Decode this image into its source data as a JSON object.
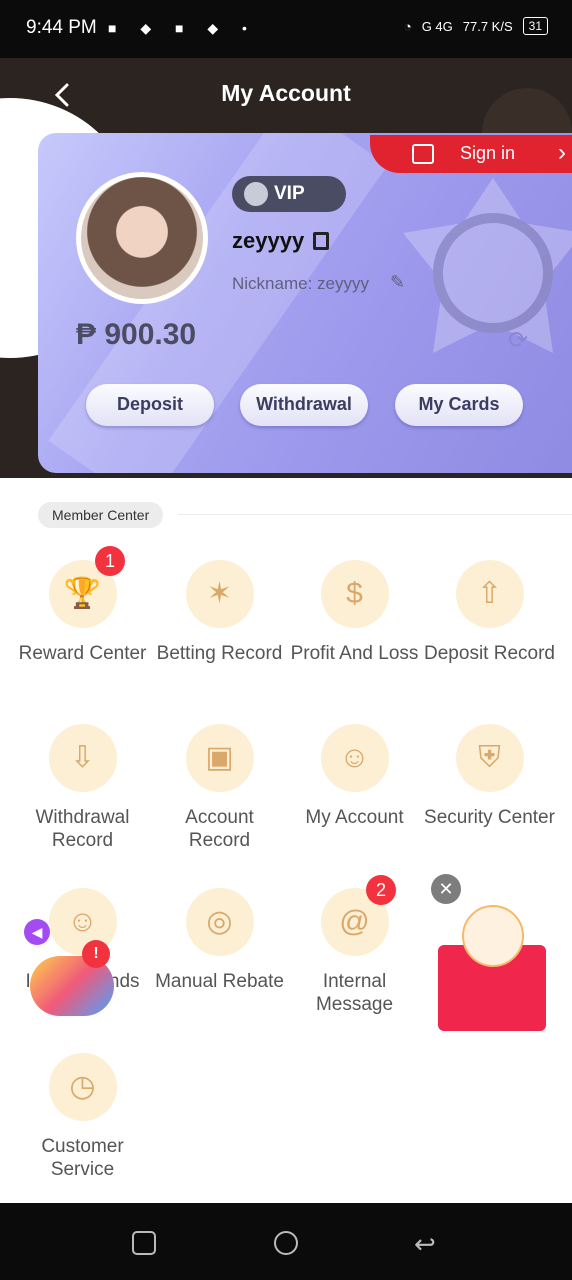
{
  "status_bar": {
    "time": "9:44 PM",
    "network": "G 4G",
    "speed": "77.7 K/S",
    "battery": "31"
  },
  "header": {
    "title": "My Account"
  },
  "profile": {
    "vip_label": "VIP",
    "username": "zeyyyy",
    "nickname": "Nickname: zeyyyy",
    "balance": "₱ 900.30",
    "sign_in": "Sign in"
  },
  "actions": {
    "deposit": "Deposit",
    "withdrawal": "Withdrawal",
    "my_cards": "My Cards"
  },
  "section_label": "Member Center",
  "menu": [
    {
      "label": "Reward Center",
      "badge": "1"
    },
    {
      "label": "Betting Record"
    },
    {
      "label": "Profit And Loss"
    },
    {
      "label": "Deposit Record"
    },
    {
      "label": "Withdrawal Record"
    },
    {
      "label": "Account Record"
    },
    {
      "label": "My Account"
    },
    {
      "label": "Security Center"
    },
    {
      "label": "Invite Friends"
    },
    {
      "label": "Manual Rebate"
    },
    {
      "label": "Internal Message",
      "badge": "2"
    },
    {
      "label": ""
    },
    {
      "label": "Customer Service"
    }
  ],
  "floating": {
    "left_alert": "!",
    "close": "✕"
  },
  "colors": {
    "accent_red": "#e0232f",
    "card_purple": "#9c98ec",
    "icon_bg": "#fdefd4"
  }
}
